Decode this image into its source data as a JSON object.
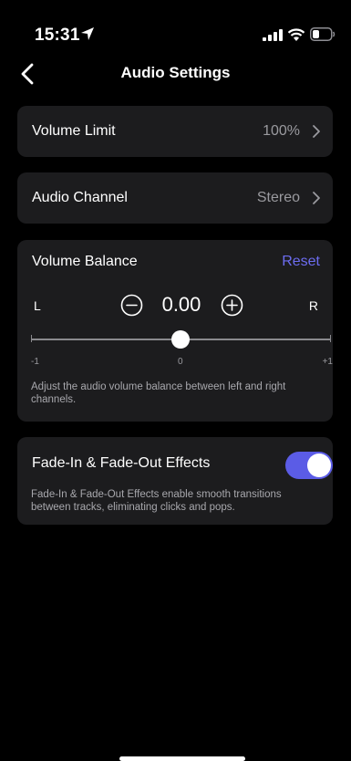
{
  "status_bar": {
    "time": "15:31",
    "icons": [
      "location-arrow-icon",
      "cellular-signal-icon",
      "wifi-icon",
      "battery-icon"
    ]
  },
  "nav": {
    "back_icon": "chevron-left-icon",
    "title": "Audio Settings"
  },
  "volume_limit": {
    "label": "Volume Limit",
    "value": "100%"
  },
  "audio_channel": {
    "label": "Audio Channel",
    "value": "Stereo"
  },
  "volume_balance": {
    "title": "Volume Balance",
    "reset_label": "Reset",
    "left_label": "L",
    "right_label": "R",
    "value": "0.00",
    "slider_min_label": "-1",
    "slider_mid_label": "0",
    "slider_max_label": "+1",
    "slider_position": 0.5,
    "description": "Adjust the audio volume balance between left and right channels."
  },
  "fade_effects": {
    "title": "Fade-In & Fade-Out Effects",
    "enabled": true,
    "description": "Fade-In & Fade-Out Effects enable smooth transitions between tracks, eliminating clicks and pops."
  },
  "colors": {
    "accent": "#5b5ce6",
    "reset_text": "#6c6cf0",
    "card_bg": "#1c1c1e",
    "page_bg": "#000000"
  }
}
